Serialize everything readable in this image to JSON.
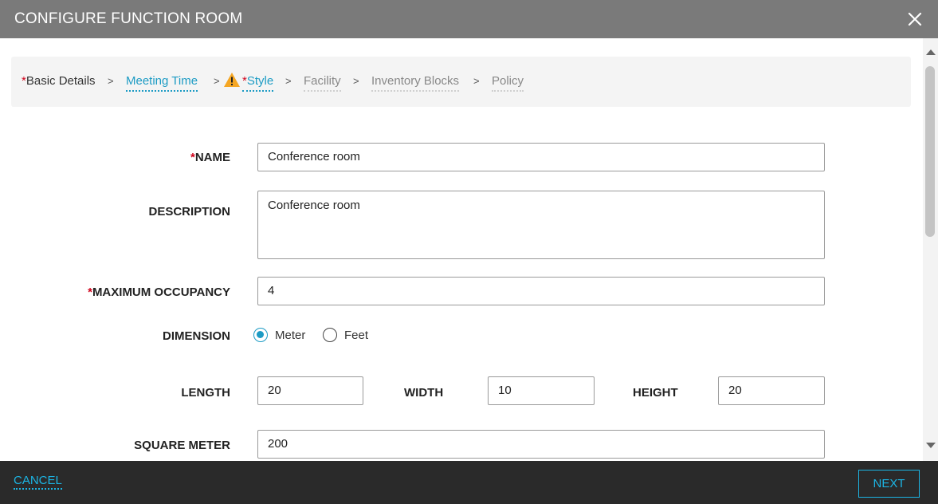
{
  "dialog": {
    "title": "CONFIGURE FUNCTION ROOM"
  },
  "steps": {
    "required_mark": "*",
    "separator": ">",
    "items": [
      {
        "label": "Basic Details",
        "required": true,
        "state": "completed"
      },
      {
        "label": "Meeting Time",
        "required": false,
        "state": "visited"
      },
      {
        "label": "Style",
        "required": true,
        "state": "warning"
      },
      {
        "label": "Facility",
        "required": false,
        "state": "pending"
      },
      {
        "label": "Inventory Blocks",
        "required": false,
        "state": "pending"
      },
      {
        "label": "Policy",
        "required": false,
        "state": "pending"
      }
    ],
    "warning_icon": "warning-triangle-icon"
  },
  "form": {
    "name": {
      "label": "NAME",
      "value": "Conference room",
      "required": true
    },
    "description": {
      "label": "DESCRIPTION",
      "value": "Conference room"
    },
    "max_occupancy": {
      "label": "MAXIMUM OCCUPANCY",
      "value": "4",
      "required": true
    },
    "dimension": {
      "label": "DIMENSION",
      "options": [
        "Meter",
        "Feet"
      ],
      "selected": "Meter"
    },
    "length": {
      "label": "LENGTH",
      "value": "20"
    },
    "width": {
      "label": "WIDTH",
      "value": "10"
    },
    "height": {
      "label": "HEIGHT",
      "value": "20"
    },
    "square_meter": {
      "label": "SQUARE METER",
      "value": "200"
    }
  },
  "footer": {
    "cancel_label": "CANCEL",
    "next_label": "NEXT"
  },
  "colors": {
    "titlebar": "#7a7a7a",
    "accent": "#1c9bc4",
    "required": "#d0021b",
    "warning": "#f5a623",
    "footer": "#2a2a2a"
  }
}
